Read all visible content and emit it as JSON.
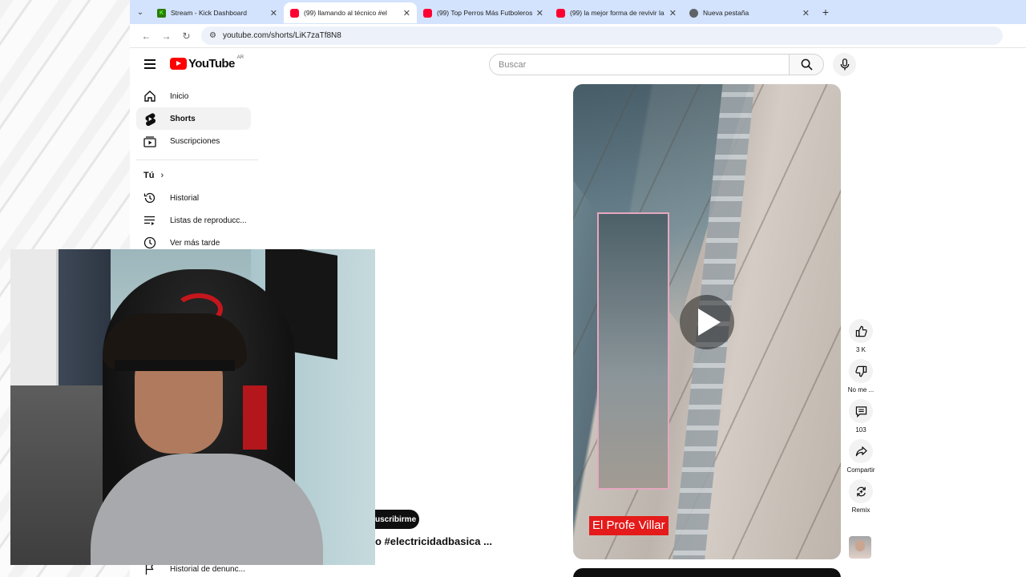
{
  "browser": {
    "tabs": [
      {
        "title": "Stream - Kick Dashboard",
        "favicon": "kick-icon",
        "active": false
      },
      {
        "title": "(99) llamando al técnico #el",
        "favicon": "youtube-icon",
        "active": true
      },
      {
        "title": "(99) Top Perros Más Futboleros",
        "favicon": "youtube-icon",
        "active": false
      },
      {
        "title": "(99) la mejor forma de revivir la",
        "favicon": "youtube-icon",
        "active": false
      },
      {
        "title": "Nueva pestaña",
        "favicon": "chrome-icon",
        "active": false
      }
    ],
    "close_glyph": "✕",
    "new_tab_glyph": "+",
    "url": "youtube.com/shorts/LiK7zaTf8N8"
  },
  "masthead": {
    "logo_text": "YouTube",
    "country_code": "AR",
    "search_placeholder": "Buscar"
  },
  "sidebar": {
    "items": [
      {
        "label": "Inicio",
        "icon": "home-icon"
      },
      {
        "label": "Shorts",
        "icon": "shorts-icon",
        "active": true
      },
      {
        "label": "Suscripciones",
        "icon": "subscriptions-icon"
      }
    ],
    "section_you": "Tú",
    "you_items": [
      {
        "label": "Historial",
        "icon": "history-icon"
      },
      {
        "label": "Listas de reproducc...",
        "icon": "playlist-icon"
      },
      {
        "label": "Ver más tarde",
        "icon": "clock-icon"
      }
    ],
    "bottom_item": "Historial de denunc..."
  },
  "short": {
    "channel_overlay": "El Profe Villar",
    "subscribe_label": "Suscribirme",
    "subscribe_visible": "uscribirme",
    "caption_visible": "o #electricidadbasica ..."
  },
  "actions": [
    {
      "icon": "like-icon",
      "label": "3 K"
    },
    {
      "icon": "dislike-icon",
      "label": "No me ..."
    },
    {
      "icon": "comment-icon",
      "label": "103"
    },
    {
      "icon": "share-icon",
      "label": "Compartir"
    },
    {
      "icon": "remix-icon",
      "label": "Remix"
    }
  ],
  "colors": {
    "tabstrip": "#d3e3fd",
    "youtube_red": "#ff0000",
    "channel_tag": "#e51a1a"
  }
}
